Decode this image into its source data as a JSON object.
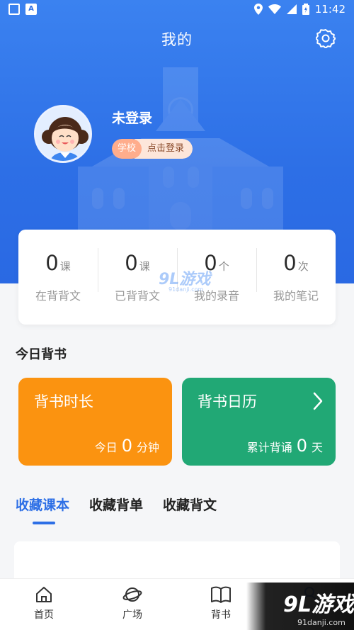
{
  "status_bar": {
    "time": "11:42",
    "left_icon_label": "A"
  },
  "header": {
    "title": "我的"
  },
  "profile": {
    "username": "未登录",
    "school_tag": "学校",
    "login_link": "点击登录"
  },
  "stats": [
    {
      "value": "0",
      "unit": "课",
      "label": "在背背文"
    },
    {
      "value": "0",
      "unit": "课",
      "label": "已背背文"
    },
    {
      "value": "0",
      "unit": "个",
      "label": "我的录音"
    },
    {
      "value": "0",
      "unit": "次",
      "label": "我的笔记"
    }
  ],
  "today": {
    "title": "今日背书",
    "duration_card": {
      "title": "背书时长",
      "prefix": "今日",
      "value": "0",
      "suffix": "分钟",
      "color": "#fb9310"
    },
    "calendar_card": {
      "title": "背书日历",
      "prefix": "累计背诵",
      "value": "0",
      "suffix": "天",
      "color": "#21a875"
    }
  },
  "tabs": [
    {
      "label": "收藏课本",
      "active": true
    },
    {
      "label": "收藏背单",
      "active": false
    },
    {
      "label": "收藏背文",
      "active": false
    }
  ],
  "bottom_nav": [
    {
      "label": "首页",
      "icon": "home-icon"
    },
    {
      "label": "广场",
      "icon": "planet-icon"
    },
    {
      "label": "背书",
      "icon": "book-icon"
    },
    {
      "label": "",
      "icon": "profile-icon"
    }
  ],
  "watermark": {
    "center_logo": "9L游戏",
    "center_site": "91danji.com",
    "corner_logo": "9L游戏",
    "corner_site": "91danji.com"
  },
  "colors": {
    "primary": "#2d6fe6",
    "orange": "#fb9310",
    "green": "#21a875"
  }
}
